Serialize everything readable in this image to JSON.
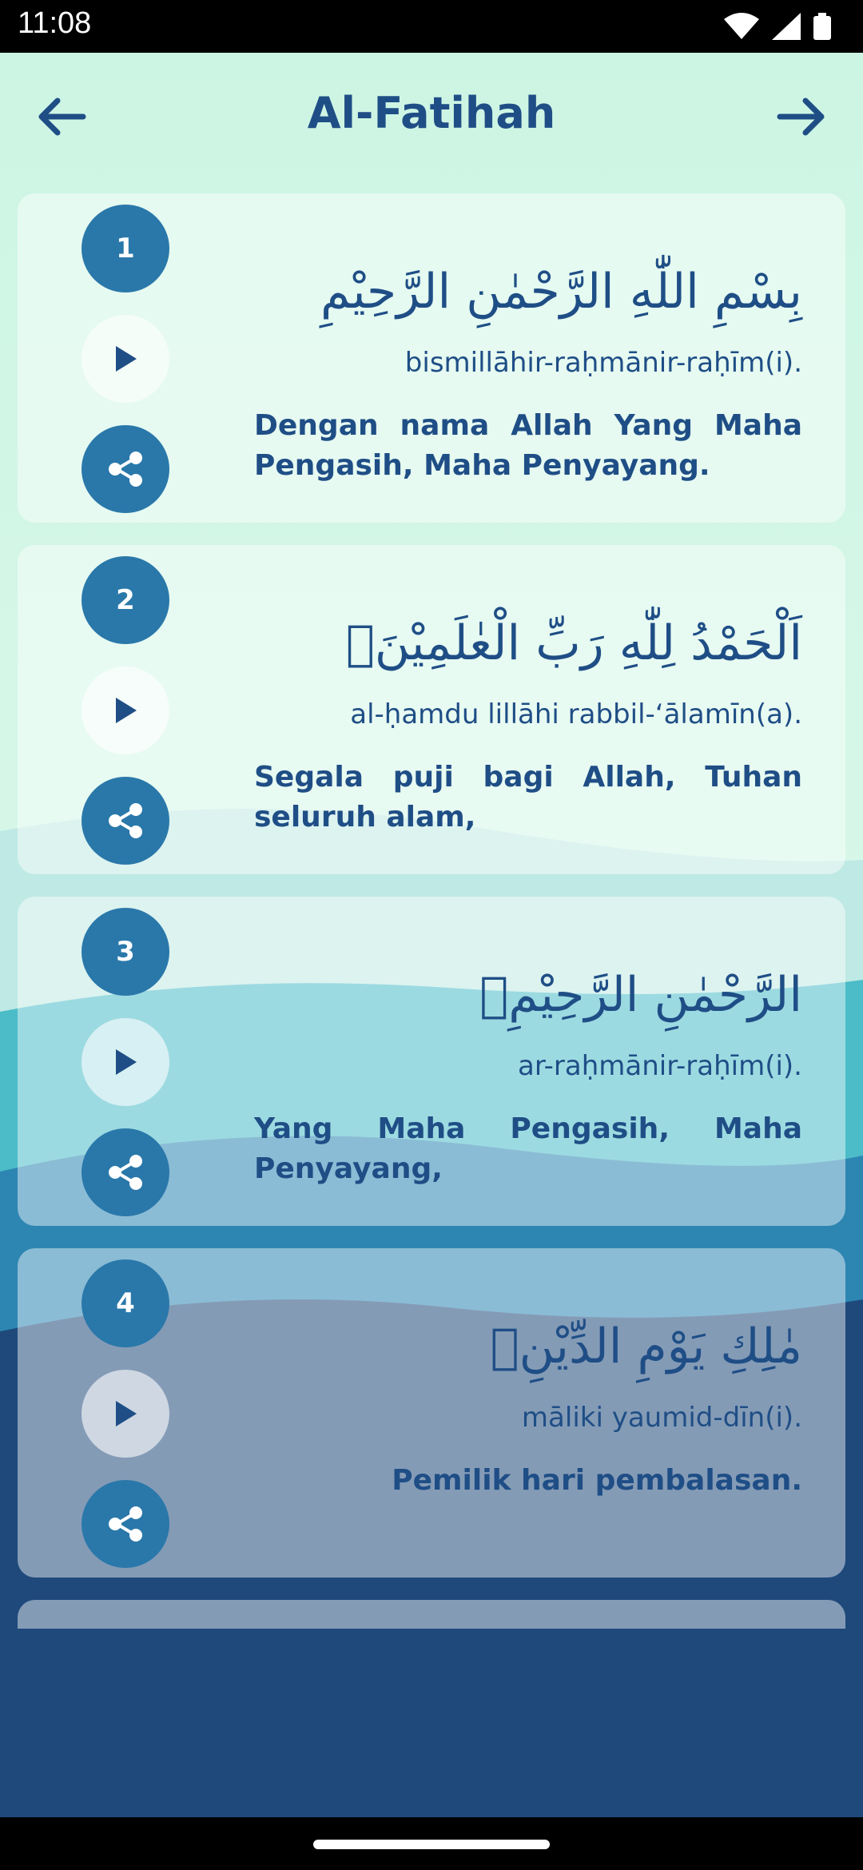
{
  "status": {
    "time": "11:08"
  },
  "header": {
    "title": "Al-Fatihah"
  },
  "verses": [
    {
      "number": "1",
      "arabic": "بِسْمِ اللّٰهِ الرَّحْمٰنِ الرَّحِيْمِ",
      "latin": "bismillāhir-raḥmānir-raḥīm(i).",
      "meaning": "Dengan nama Allah Yang Maha Pengasih, Maha Penyayang."
    },
    {
      "number": "2",
      "arabic": "اَلْحَمْدُ لِلّٰهِ رَبِّ الْعٰلَمِيْنَۙ",
      "latin": "al-ḥamdu lillāhi rabbil-‘ālamīn(a).",
      "meaning": "Segala puji bagi Allah, Tuhan seluruh alam,"
    },
    {
      "number": "3",
      "arabic": "الرَّحْمٰنِ الرَّحِيْمِۙ",
      "latin": "ar-raḥmānir-raḥīm(i).",
      "meaning": "Yang Maha Pengasih, Maha Penyayang,"
    },
    {
      "number": "4",
      "arabic": "مٰلِكِ يَوْمِ الدِّيْنِۗ",
      "latin": "māliki yaumid-dīn(i).",
      "meaning": "Pemilik hari pembalasan."
    }
  ],
  "colors": {
    "accent": "#2a78aa",
    "text": "#1f4e86",
    "top_bg": "#d2f5e6",
    "bottom_bg": "#1f497b"
  },
  "icons": {
    "back": "arrow-left-icon",
    "next": "arrow-right-icon",
    "play": "play-icon",
    "share": "share-icon"
  }
}
